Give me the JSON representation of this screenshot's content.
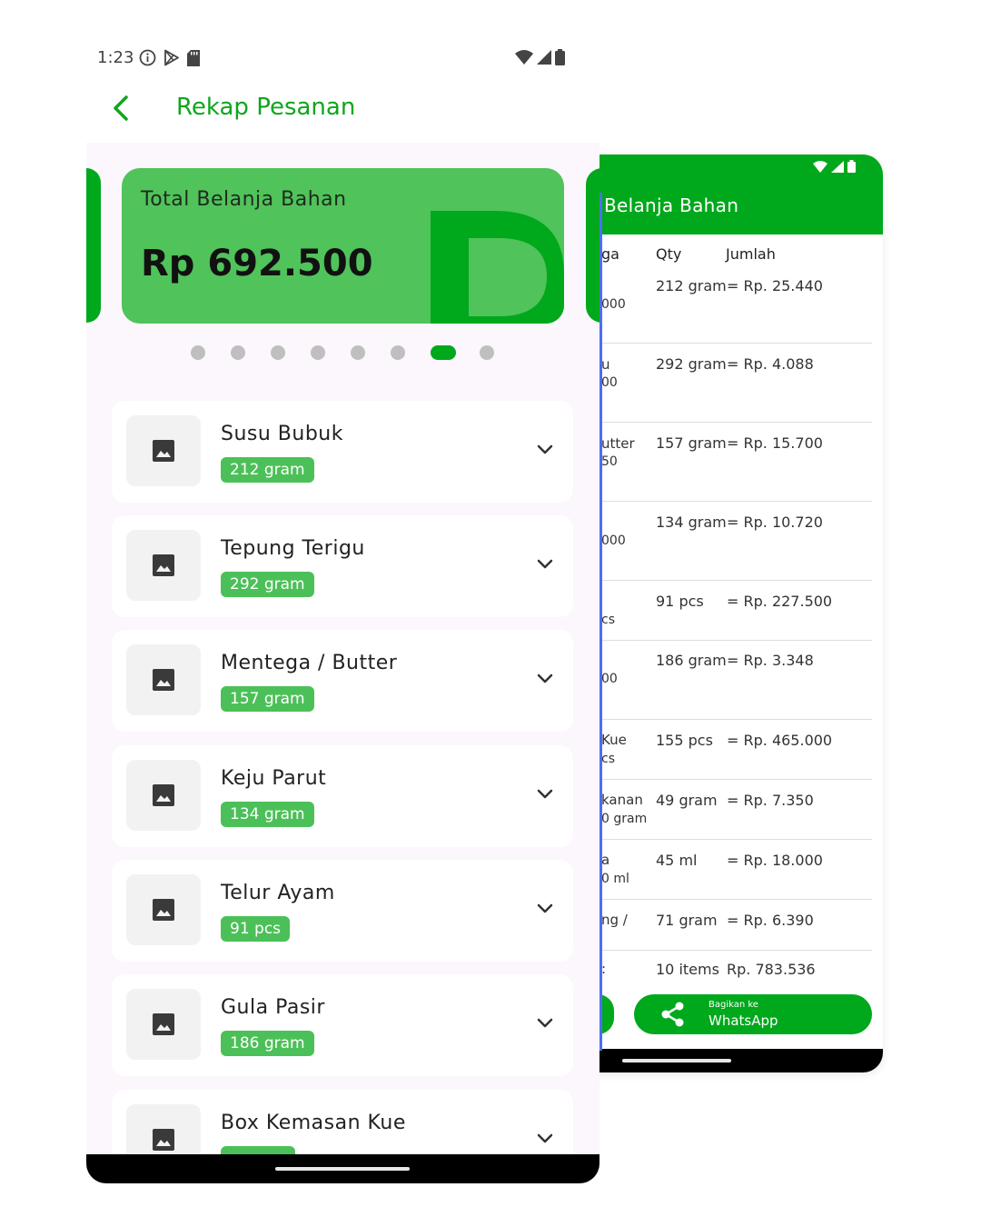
{
  "back_screen": {
    "title": "Belanja Bahan",
    "columns": {
      "price": "ga",
      "qty": "Qty",
      "amount": "Jumlah"
    },
    "rows": [
      {
        "name": "",
        "sub": "000",
        "qty": "212 gram",
        "amount": "= Rp. 25.440"
      },
      {
        "name": "u",
        "sub": "00",
        "qty": "292 gram",
        "amount": "= Rp. 4.088"
      },
      {
        "name": "utter",
        "sub": "50",
        "qty": "157 gram",
        "amount": "= Rp. 15.700"
      },
      {
        "name": "",
        "sub": "000",
        "qty": "134 gram",
        "amount": "= Rp. 10.720"
      },
      {
        "name": "",
        "sub": "cs",
        "qty": "91 pcs",
        "amount": "= Rp. 227.500"
      },
      {
        "name": "",
        "sub": "00",
        "qty": "186 gram",
        "amount": "= Rp. 3.348"
      },
      {
        "name": "Kue",
        "sub": "cs",
        "qty": "155 pcs",
        "amount": "= Rp. 465.000"
      },
      {
        "name": "kanan",
        "sub": "0 gram",
        "qty": "49 gram",
        "amount": "= Rp. 7.350"
      },
      {
        "name": "a",
        "sub": "0 ml",
        "qty": "45 ml",
        "amount": "= Rp. 18.000"
      },
      {
        "name": "ng /",
        "sub": "",
        "qty": "71 gram",
        "amount": "= Rp. 6.390"
      }
    ],
    "total": {
      "label": ":",
      "items": "10 items",
      "amount": "Rp. 783.536"
    },
    "share_button": {
      "small": "Bagikan ke",
      "big": "WhatsApp"
    },
    "share_icon": "share-icon"
  },
  "front_screen": {
    "status": {
      "time": "1:23"
    },
    "app_bar": {
      "title": "Rekap Pesanan",
      "back_icon": "chevron-left-icon"
    },
    "summary_card": {
      "label": "Total Belanja Bahan",
      "amount": "Rp 692.500"
    },
    "carousel": {
      "page_count": 8,
      "active_index": 6
    },
    "items": [
      {
        "name": "Susu Bubuk",
        "qty": "212 gram"
      },
      {
        "name": "Tepung Terigu",
        "qty": "292 gram"
      },
      {
        "name": "Mentega / Butter",
        "qty": "157 gram"
      },
      {
        "name": "Keju Parut",
        "qty": "134 gram"
      },
      {
        "name": "Telur Ayam",
        "qty": "91 pcs"
      },
      {
        "name": "Gula Pasir",
        "qty": "186 gram"
      },
      {
        "name": "Box Kemasan Kue",
        "qty": ""
      }
    ]
  },
  "colors": {
    "brand_green": "#00a81c",
    "card_green": "#50c35a",
    "badge_green": "#4cc058",
    "title_green": "#0ea61d",
    "background_tint": "#fcf6fd",
    "scroll_indicator": "#4c6ef5"
  }
}
